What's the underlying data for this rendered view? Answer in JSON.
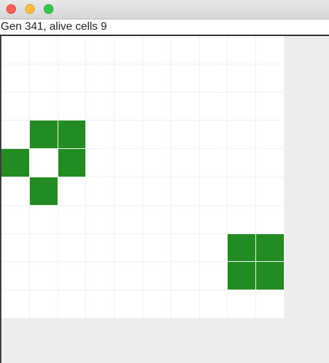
{
  "window": {
    "controls": [
      "close-button",
      "minimize-button",
      "zoom-button"
    ]
  },
  "status": {
    "text": "Gen 341, alive cells 9"
  },
  "board": {
    "rows": 10,
    "cols": 10,
    "alive_color": "#228b22",
    "dead_color": "#ffffff",
    "grid_line_color": "#f0f0f0",
    "alive_cells": [
      [
        3,
        1
      ],
      [
        3,
        2
      ],
      [
        4,
        0
      ],
      [
        4,
        2
      ],
      [
        5,
        1
      ],
      [
        7,
        8
      ],
      [
        7,
        9
      ],
      [
        8,
        8
      ],
      [
        8,
        9
      ]
    ]
  }
}
